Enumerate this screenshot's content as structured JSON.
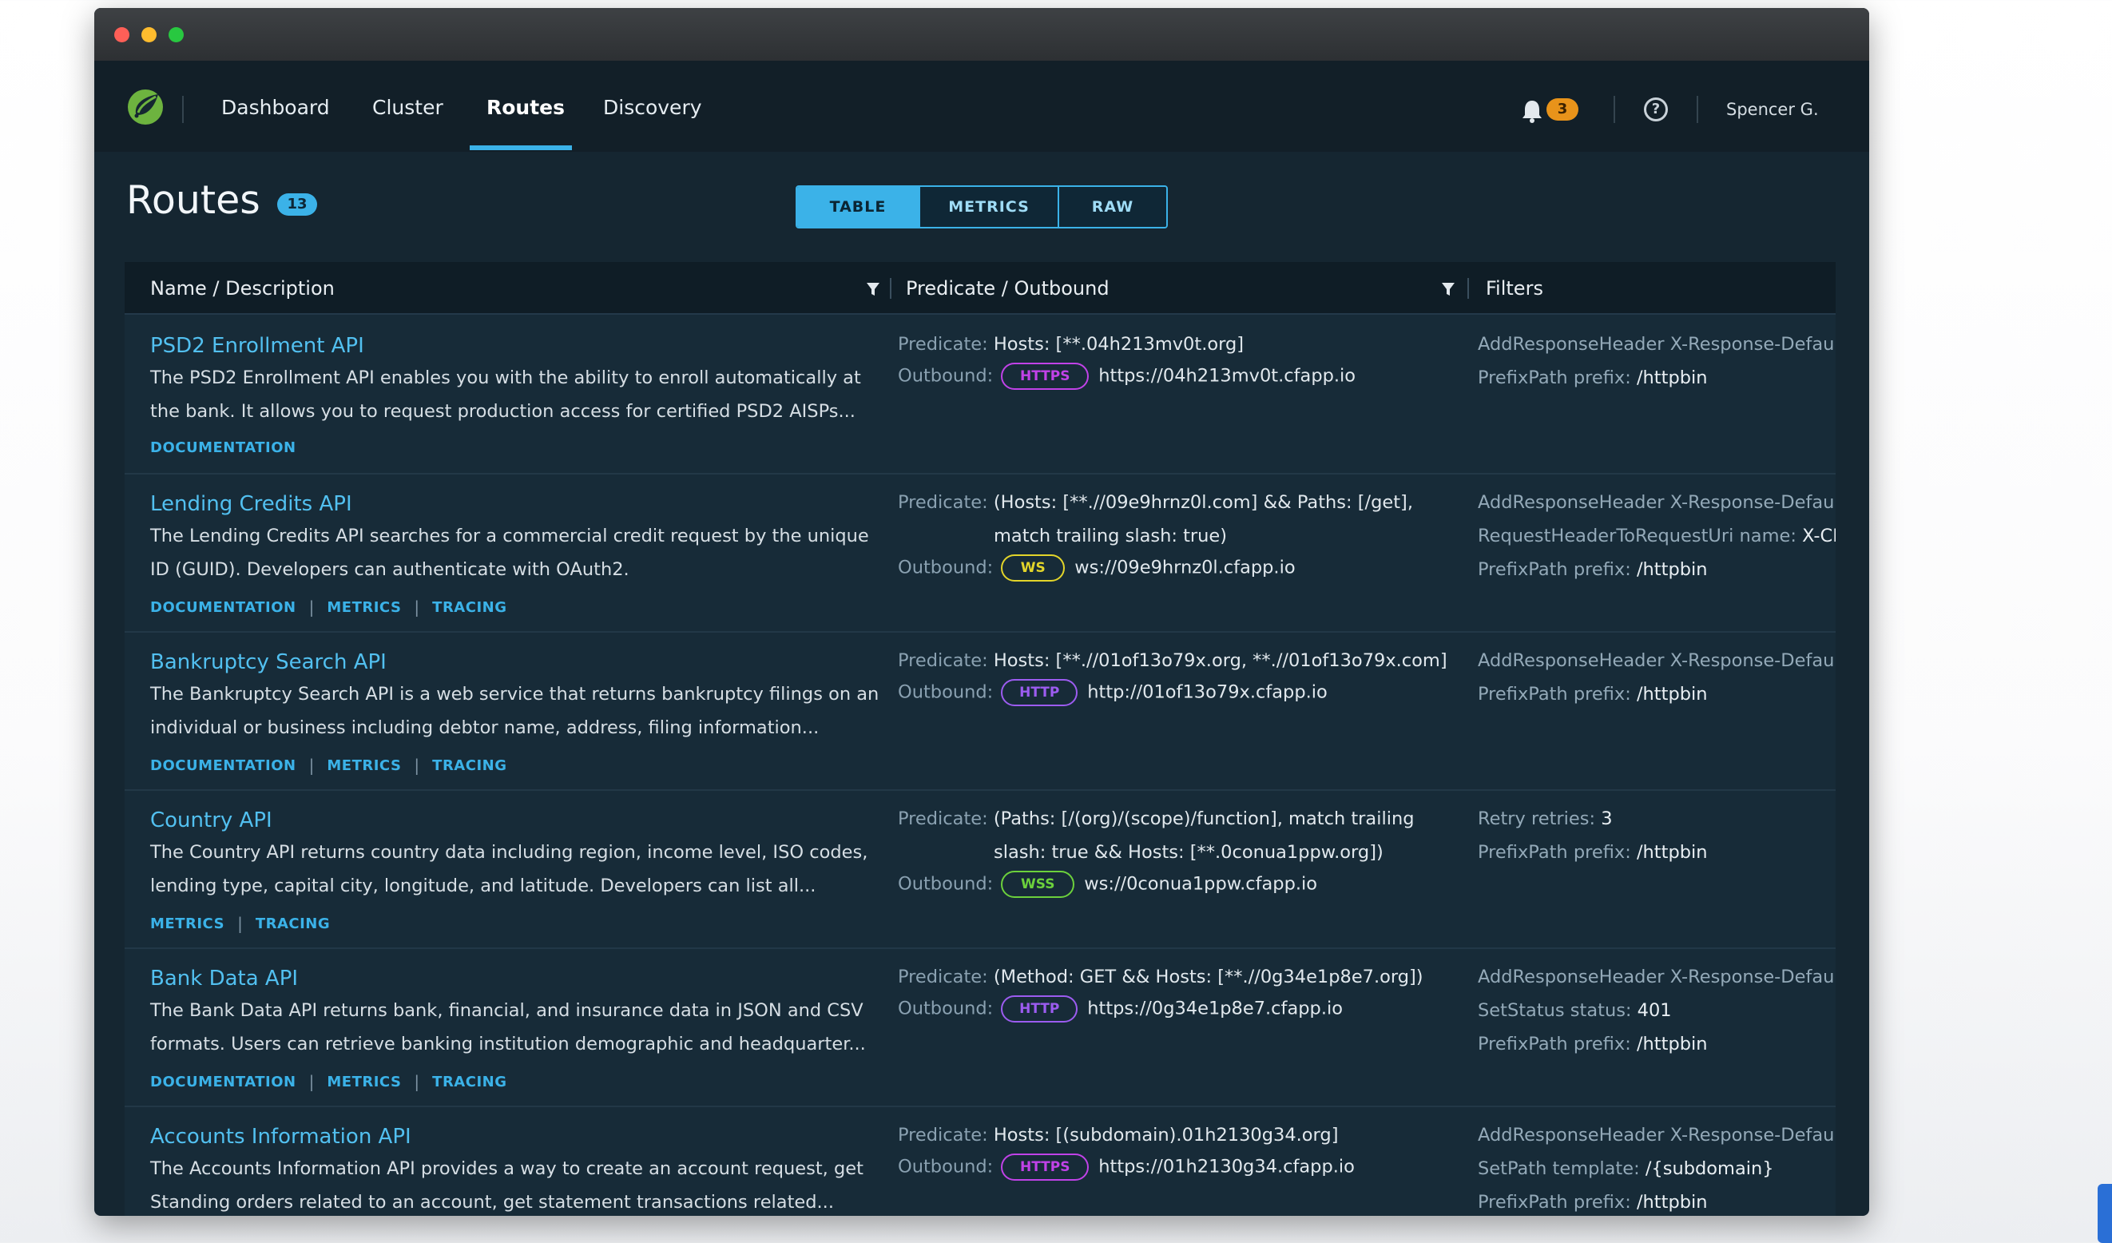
{
  "nav": {
    "links": [
      "Dashboard",
      "Cluster",
      "Routes",
      "Discovery"
    ],
    "notifications": "3",
    "help": "?",
    "user": "Spencer G."
  },
  "page": {
    "title": "Routes",
    "count": "13",
    "views": [
      "TABLE",
      "METRICS",
      "RAW"
    ],
    "active_view": "TABLE"
  },
  "table": {
    "columns": [
      "Name / Description",
      "Predicate / Outbound",
      "Filters"
    ],
    "rows": [
      {
        "name": "PSD2 Enrollment API",
        "desc": [
          "The PSD2 Enrollment API enables you with the ability to enroll automatically at",
          "the bank. It allows you to request production access for certified PSD2 AISPs..."
        ],
        "links": [
          "DOCUMENTATION"
        ],
        "predicate_label": "Predicate:",
        "predicate": [
          "Hosts: [**.04h213mv0t.org]"
        ],
        "outbound_label": "Outbound:",
        "protocol": "HTTPS",
        "outbound": "https://04h213mv0t.cfapp.io",
        "filters": [
          {
            "key": "AddResponseHeader X-Response-Default-Foo",
            "val": ""
          },
          {
            "key": "PrefixPath prefix: ",
            "val": "/httpbin"
          }
        ]
      },
      {
        "name": "Lending Credits API",
        "desc": [
          "The Lending Credits API searches for a commercial credit request by the unique",
          "ID (GUID). Developers can authenticate with OAuth2."
        ],
        "links": [
          "DOCUMENTATION",
          "METRICS",
          "TRACING"
        ],
        "predicate_label": "Predicate:",
        "predicate": [
          "(Hosts: [**.//09e9hrnz0l.com] && Paths: [/get],",
          "match trailing slash: true)"
        ],
        "outbound_label": "Outbound:",
        "protocol": "WS",
        "outbound": "ws://09e9hrnz0l.cfapp.io",
        "filters": [
          {
            "key": "AddResponseHeader X-Response-Default-Foo",
            "val": ""
          },
          {
            "key": "RequestHeaderToRequestUri name: ",
            "val": "X-CF-Forwarded-Url"
          },
          {
            "key": "PrefixPath prefix: ",
            "val": "/httpbin"
          }
        ]
      },
      {
        "name": "Bankruptcy Search API",
        "desc": [
          "The Bankruptcy Search API is a web service that returns bankruptcy filings on an",
          "individual or business including debtor name, address, filing information..."
        ],
        "links": [
          "DOCUMENTATION",
          "METRICS",
          "TRACING"
        ],
        "predicate_label": "Predicate:",
        "predicate": [
          "Hosts: [**.//01of13o79x.org, **.//01of13o79x.com]"
        ],
        "outbound_label": "Outbound:",
        "protocol": "HTTP",
        "outbound": "http://01of13o79x.cfapp.io",
        "filters": [
          {
            "key": "AddResponseHeader X-Response-Default-Foo",
            "val": ""
          },
          {
            "key": "PrefixPath prefix: ",
            "val": "/httpbin"
          }
        ]
      },
      {
        "name": "Country API",
        "desc": [
          "The Country API returns country data including region, income level, ISO codes,",
          "lending type, capital city, longitude, and latitude. Developers can list all..."
        ],
        "links": [
          "METRICS",
          "TRACING"
        ],
        "predicate_label": "Predicate:",
        "predicate": [
          "(Paths: [/(org)/(scope)/function], match trailing",
          "slash: true && Hosts: [**.0conua1ppw.org])"
        ],
        "outbound_label": "Outbound:",
        "protocol": "WSS",
        "outbound": "ws://0conua1ppw.cfapp.io",
        "filters": [
          {
            "key": "Retry retries: ",
            "val": "3"
          },
          {
            "key": "PrefixPath prefix: ",
            "val": "/httpbin"
          }
        ]
      },
      {
        "name": "Bank Data API",
        "desc": [
          "The Bank Data API returns bank, financial, and insurance data in JSON and CSV",
          "formats. Users can retrieve banking institution demographic and headquarter..."
        ],
        "links": [
          "DOCUMENTATION",
          "METRICS",
          "TRACING"
        ],
        "predicate_label": "Predicate:",
        "predicate": [
          "(Method: GET && Hosts: [**.//0g34e1p8e7.org])"
        ],
        "outbound_label": "Outbound:",
        "protocol": "HTTP",
        "outbound": "https://0g34e1p8e7.cfapp.io",
        "filters": [
          {
            "key": "AddResponseHeader X-Response-Default-Foo",
            "val": ""
          },
          {
            "key": "SetStatus status: ",
            "val": "401"
          },
          {
            "key": "PrefixPath prefix: ",
            "val": "/httpbin"
          }
        ]
      },
      {
        "name": "Accounts Information API",
        "desc": [
          "The Accounts Information API provides a way to create an account request, get",
          "Standing orders related to an account, get statement transactions related..."
        ],
        "links": [],
        "predicate_label": "Predicate:",
        "predicate": [
          "Hosts: [(subdomain).01h2130g34.org]"
        ],
        "outbound_label": "Outbound:",
        "protocol": "HTTPS",
        "outbound": "https://01h2130g34.cfapp.io",
        "filters": [
          {
            "key": "AddResponseHeader X-Response-Default-Foo",
            "val": ""
          },
          {
            "key": "SetPath template: ",
            "val": "/{subdomain}"
          },
          {
            "key": "PrefixPath prefix: ",
            "val": "/httpbin"
          }
        ]
      }
    ]
  },
  "protocol_colors": {
    "HTTPS": "#c142e8",
    "HTTP": "#9c5cf0",
    "WS": "#e3d52a",
    "WSS": "#6cd13c"
  },
  "icons": [
    "spring-logo-icon",
    "bell-icon",
    "help-icon",
    "filter-funnel-icon"
  ]
}
